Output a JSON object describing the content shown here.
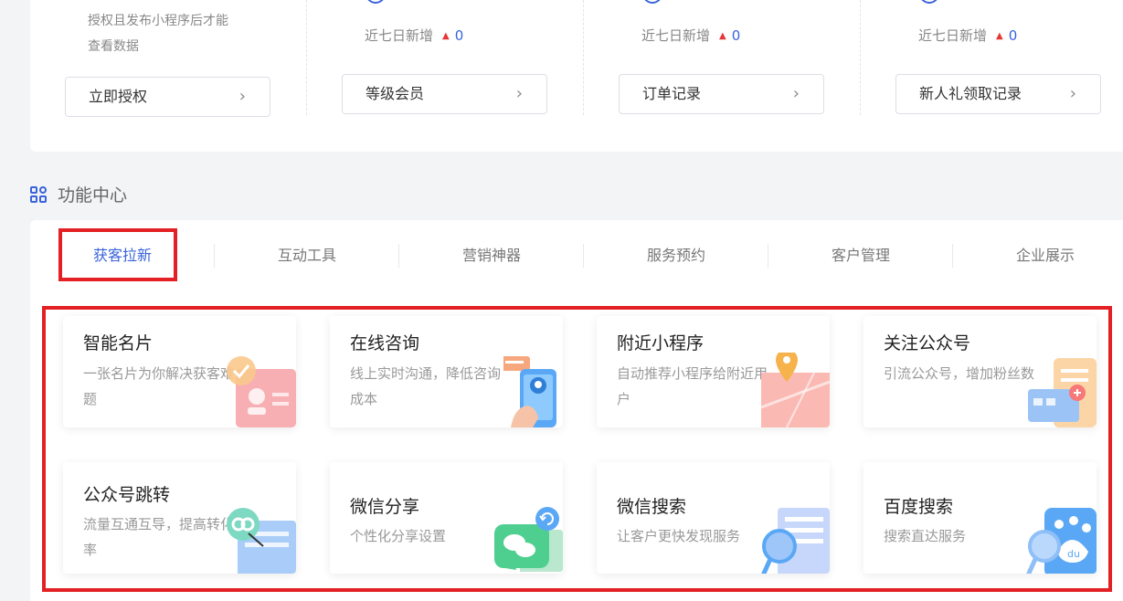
{
  "stats": {
    "hint_line1": "授权且发布小程序后才能",
    "hint_line2": "查看数据",
    "recent_label": "近七日新增",
    "recent_values": [
      "0",
      "0",
      "0"
    ],
    "buttons": [
      "立即授权",
      "等级会员",
      "订单记录",
      "新人礼领取记录"
    ],
    "chevron": "›"
  },
  "section": {
    "title": "功能中心"
  },
  "tabs": [
    "获客拉新",
    "互动工具",
    "营销神器",
    "服务预约",
    "客户管理",
    "企业展示"
  ],
  "active_tab": "获客拉新",
  "cards": [
    {
      "title": "智能名片",
      "desc": "一张名片为你解决获客难题",
      "icon": "business-card-icon"
    },
    {
      "title": "在线咨询",
      "desc": "线上实时沟通，降低咨询成本",
      "icon": "consult-phone-icon"
    },
    {
      "title": "附近小程序",
      "desc": "自动推荐小程序给附近用户",
      "icon": "map-pin-icon"
    },
    {
      "title": "关注公众号",
      "desc": "引流公众号，增加粉丝数",
      "icon": "follow-account-icon"
    },
    {
      "title": "公众号跳转",
      "desc": "流量互通互导，提高转化率",
      "icon": "link-jump-icon"
    },
    {
      "title": "微信分享",
      "desc": "个性化分享设置",
      "icon": "wechat-share-icon"
    },
    {
      "title": "微信搜索",
      "desc": "让客户更快发现服务",
      "icon": "search-magnifier-icon"
    },
    {
      "title": "百度搜索",
      "desc": "搜索直达服务",
      "icon": "baidu-icon"
    }
  ],
  "colors": {
    "accent": "#3a63db",
    "highlight_red": "#e32023",
    "up_red": "#e63636"
  }
}
